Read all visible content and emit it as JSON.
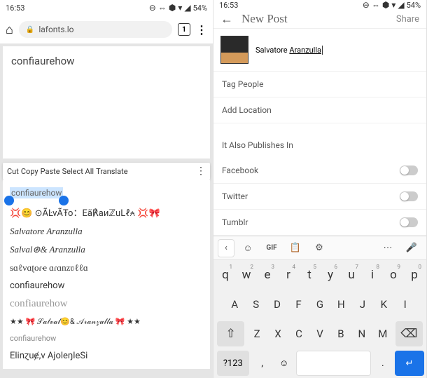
{
  "status": {
    "time": "16:53",
    "battery": "54%",
    "icons": [
      "⊙",
      "⇔",
      "⬢",
      "▾",
      "◢"
    ]
  },
  "browser": {
    "url": "lafonts.lo",
    "tabs": "1"
  },
  "left": {
    "placeholder": "confiaurehow",
    "actions": [
      "Cut",
      "Copy",
      "Paste",
      "Select All",
      "Translate"
    ],
    "selected": "confiaurehow",
    "fonts": [
      "💢😊 ⊙ÃĿvÃŦo：Eã℟aиℤuLℓ⍲ 💢🎀",
      "Salvatore Aranzulla",
      "Salval⊛& Aranzulla",
      "sɑℓvɑʈoɾҽ ɑɾɑnzʋℓℓɑ",
      "confiaurehow",
      "confiaurehow",
      "★★ 🎀 𝒮𝒶𝓁𝓋𝒶𝓁😊& 𝒜𝓇𝒶𝓃𝓏𝓊𝓁𝓁𝒶 🎀 ★★",
      "confiaurehow",
      "Elinɀuɇ,v AjoleŋleSi"
    ]
  },
  "right": {
    "title": "New Post",
    "share": "Share",
    "caption_name": "Salvatore",
    "caption_surname": "Aranzulla",
    "tag": "Tag People",
    "location": "Add Location",
    "also": "It Also Publishes In",
    "socials": [
      "Facebook",
      "Twitter",
      "Tumblr"
    ]
  },
  "keyboard": {
    "row1": [
      [
        "q",
        "1"
      ],
      [
        "w",
        "2"
      ],
      [
        "e",
        "3"
      ],
      [
        "r",
        "4"
      ],
      [
        "t",
        "5"
      ],
      [
        "y",
        "6"
      ],
      [
        "u",
        "7"
      ],
      [
        "i",
        "8"
      ],
      [
        "o",
        "9"
      ],
      [
        "p",
        "0"
      ]
    ],
    "row2": [
      "A",
      "S",
      "D",
      "F",
      "G",
      "H",
      "J",
      "K",
      "I"
    ],
    "row3": [
      "Z",
      "X",
      "C",
      "V",
      "B",
      "N",
      "M"
    ],
    "sym": "?123",
    "comma": ",",
    "period": "."
  }
}
